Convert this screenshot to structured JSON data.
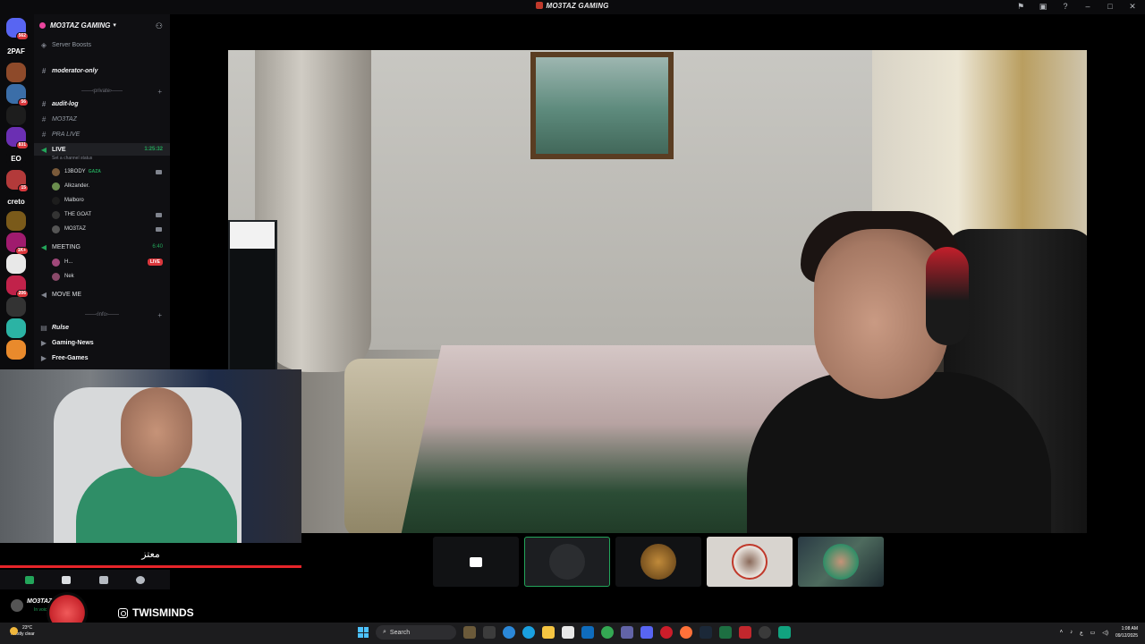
{
  "window": {
    "title": "MO3TAZ GAMING"
  },
  "server_rail": [
    {
      "label": "",
      "badge": "562",
      "color": "#5865f2"
    },
    {
      "label": "2PAF",
      "badge": "",
      "color": "#0b0b0d"
    },
    {
      "label": "",
      "badge": "",
      "color": "#8e4a2a"
    },
    {
      "label": "",
      "badge": "56",
      "color": "#3b6ea8"
    },
    {
      "label": "",
      "badge": "",
      "color": "#1d1d1d"
    },
    {
      "label": "",
      "badge": "831",
      "color": "#6b2fb3"
    },
    {
      "label": "EO",
      "badge": "",
      "color": "#0b0b0d"
    },
    {
      "label": "",
      "badge": "15",
      "color": "#b33a3a"
    },
    {
      "label": "creto",
      "badge": "",
      "color": "#0b0b0d"
    },
    {
      "label": "",
      "badge": "",
      "color": "#7a5a1a"
    },
    {
      "label": "",
      "badge": "1K+",
      "color": "#a01b6e"
    },
    {
      "label": "",
      "badge": "",
      "color": "#e8e8e8"
    },
    {
      "label": "",
      "badge": "206",
      "color": "#c1224a"
    },
    {
      "label": "",
      "badge": "",
      "color": "#333"
    },
    {
      "label": "",
      "badge": "",
      "color": "#2bb3a4"
    },
    {
      "label": "",
      "badge": "",
      "color": "#e98a2c"
    }
  ],
  "sidebar": {
    "server_name": "MO3TAZ GAMING",
    "server_boosts": "Server Boosts",
    "channels": {
      "moderator_only": "moderator-only",
      "private_category": "private",
      "audit_log": "audit-log",
      "mo3taz": "MO3TAZ",
      "pra_live": "PRA LIVE",
      "live": "LIVE",
      "live_timer": "1:25:32",
      "set_status": "Set a channel status",
      "meeting": "MEETING",
      "meeting_timer": "6:40",
      "move_me": "MOVE ME",
      "info_category": "Info",
      "rulse": "Rulse",
      "gaming_news": "Gaming-News",
      "free_games": "Free-Games"
    },
    "live_users": [
      {
        "name": "13BODY",
        "tag": "GAZA",
        "color": "#7a5a3a",
        "icon": "camera-icon"
      },
      {
        "name": "Alkzander.",
        "tag": "",
        "color": "#6b8e4e",
        "icon": ""
      },
      {
        "name": "Malboro",
        "tag": "",
        "color": "#1d1d1d",
        "icon": ""
      },
      {
        "name": "THE GOAT",
        "tag": "",
        "color": "#333",
        "icon": "camera-icon"
      },
      {
        "name": "MO3TAZ",
        "tag": "",
        "color": "#555",
        "icon": "camera-icon"
      }
    ],
    "meeting_users": [
      {
        "name": "H...",
        "live": "LIVE",
        "color": "#a0487a"
      },
      {
        "name": "Nek",
        "live": "",
        "color": "#8a4a6a"
      }
    ]
  },
  "facecam": {
    "caption": "معتز"
  },
  "user_panel": {
    "username": "MO3TAZ",
    "status": "In voice"
  },
  "overlay": {
    "instagram_handle": "TWISMINDS"
  },
  "taskbar": {
    "temperature": "23°C",
    "weather": "Mostly clear",
    "search_placeholder": "Search",
    "time": "1:08 AM",
    "date": "09/12/2025",
    "language": "ع"
  },
  "colors": {
    "accent_green": "#23a55a",
    "live_red": "#da373c",
    "brand_red": "#e62429"
  }
}
